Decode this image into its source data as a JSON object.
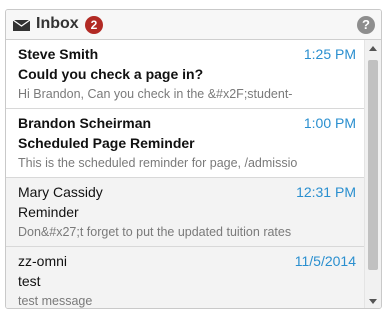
{
  "header": {
    "title": "Inbox",
    "unread_count": "2",
    "help_symbol": "?"
  },
  "messages": [
    {
      "from": "Steve Smith",
      "time": "1:25 PM",
      "subject": "Could you check a page in?",
      "preview": "Hi Brandon, Can you check in the &#x2F;student-",
      "unread": true
    },
    {
      "from": "Brandon Scheirman",
      "time": "1:00 PM",
      "subject": "Scheduled Page Reminder",
      "preview": "This is the scheduled reminder for page, /admissio",
      "unread": true
    },
    {
      "from": "Mary Cassidy",
      "time": "12:31 PM",
      "subject": "Reminder",
      "preview": "Don&#x27;t forget to put the updated tuition rates",
      "unread": false
    },
    {
      "from": "zz-omni",
      "time": "11/5/2014",
      "subject": "test",
      "preview": "test message",
      "unread": false
    }
  ],
  "colors": {
    "badge": "#b22a24",
    "time": "#2a8fcf",
    "read_bg": "#f3f3f3"
  }
}
